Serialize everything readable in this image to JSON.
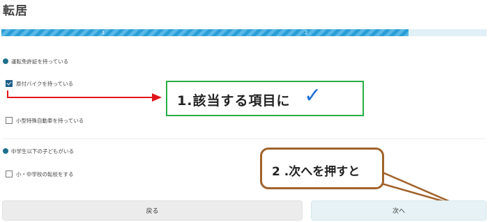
{
  "page": {
    "title": "転居"
  },
  "progress": {
    "steps": [
      "1",
      "2"
    ],
    "current_fraction": 0.84
  },
  "sections": [
    {
      "heading": "運転免許証を持っている",
      "options": [
        {
          "label": "原付バイクを持っている",
          "checked": true
        },
        {
          "label": "小型特殊自動車を持っている",
          "checked": false
        }
      ]
    },
    {
      "heading": "中学生以下の子どもがいる",
      "options": [
        {
          "label": "小・中学校の転校をする",
          "checked": false
        }
      ]
    }
  ],
  "annotations": {
    "step1": "1.該当する項目に",
    "step1_mark": "✓",
    "step2": "2 .次へを押すと"
  },
  "buttons": {
    "back": "戻る",
    "next": "次へ"
  },
  "colors": {
    "accent": "#2a9fd6",
    "dot": "#1f6f8b",
    "annotation_red": "#e0141a",
    "annotation_green": "#27ae45",
    "annotation_brown": "#a0622b",
    "check_blue": "#1f6fd6"
  }
}
